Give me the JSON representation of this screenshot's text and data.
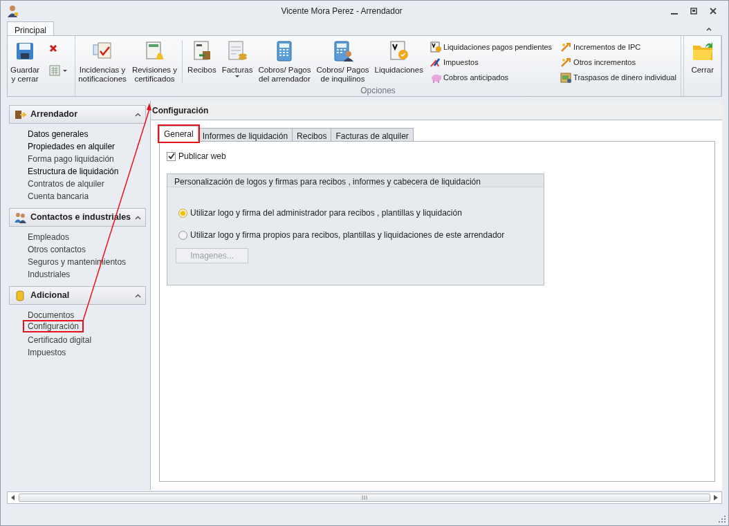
{
  "window": {
    "title": "Vicente Mora Perez - Arrendador"
  },
  "ribbon_tabs": [
    {
      "label": "Principal",
      "selected": true
    }
  ],
  "ribbon_groups": [
    {
      "items": [
        {
          "kind": "large",
          "label": "Guardar\ny cerrar"
        },
        {
          "kind": "small_stack",
          "items": [
            {
              "kind": "icon"
            },
            {
              "kind": "icon_menu"
            }
          ]
        }
      ]
    },
    {
      "label": "Opciones",
      "items": [
        {
          "kind": "large",
          "label": "Incidencias y\nnotificaciones"
        },
        {
          "kind": "large",
          "label": "Revisiones y\ncertificados"
        },
        {
          "kind": "separator"
        },
        {
          "kind": "large",
          "label": "Recibos"
        },
        {
          "kind": "large_menu",
          "label": "Facturas"
        },
        {
          "kind": "large",
          "label": "Cobros/ Pagos\ndel arrendador"
        },
        {
          "kind": "large",
          "label": "Cobros/ Pagos\nde inquilinos"
        },
        {
          "kind": "large",
          "label": "Liquidaciones"
        },
        {
          "kind": "small_stack",
          "items": [
            {
              "kind": "text",
              "label": "Liquidaciones pagos pendientes"
            },
            {
              "kind": "text",
              "label": "Impuestos"
            },
            {
              "kind": "text",
              "label": "Cobros anticipados"
            }
          ]
        },
        {
          "kind": "small_stack",
          "items": [
            {
              "kind": "text",
              "label": "Incrementos de IPC"
            },
            {
              "kind": "text",
              "label": "Otros incrementos"
            },
            {
              "kind": "text",
              "label": "Traspasos de dinero individual"
            }
          ]
        }
      ]
    },
    {
      "items": [
        {
          "kind": "large",
          "label": "Cerrar"
        }
      ]
    }
  ],
  "sidebar": [
    {
      "title": "Arrendador",
      "expanded": true,
      "items": [
        {
          "label": "Datos generales",
          "emphasized": true,
          "highlighted": false
        },
        {
          "label": "Propiedades en alquiler",
          "emphasized": true,
          "highlighted": false
        },
        {
          "label": "Forma pago liquidación",
          "emphasized": false,
          "highlighted": false
        },
        {
          "label": "Estructura de liquidación",
          "emphasized": true,
          "highlighted": false
        },
        {
          "label": "Contratos de alquiler",
          "emphasized": false,
          "highlighted": false
        },
        {
          "label": "Cuenta bancaria",
          "emphasized": false,
          "highlighted": false
        }
      ]
    },
    {
      "title": "Contactos e industriales",
      "expanded": true,
      "items": [
        {
          "label": "Empleados",
          "emphasized": false,
          "highlighted": false
        },
        {
          "label": "Otros contactos",
          "emphasized": false,
          "highlighted": false
        },
        {
          "label": "Seguros y mantenimientos",
          "emphasized": false,
          "highlighted": false
        },
        {
          "label": "Industriales",
          "emphasized": false,
          "highlighted": false
        }
      ]
    },
    {
      "title": "Adicional",
      "expanded": true,
      "items": [
        {
          "label": "Documentos",
          "emphasized": false,
          "highlighted": false
        },
        {
          "label": "Configuración",
          "emphasized": false,
          "highlighted": true
        },
        {
          "label": "Certificado digital",
          "emphasized": false,
          "highlighted": false
        },
        {
          "label": "Impuestos",
          "emphasized": false,
          "highlighted": false
        }
      ]
    }
  ],
  "content": {
    "title": "Configuración",
    "tabs": [
      {
        "label": "General",
        "selected": true,
        "highlighted": true
      },
      {
        "label": "Informes de liquidación",
        "selected": false,
        "highlighted": false
      },
      {
        "label": "Recibos",
        "selected": false,
        "highlighted": false
      },
      {
        "label": "Facturas de alquiler",
        "selected": false,
        "highlighted": false
      }
    ],
    "publish_checkbox": {
      "label": "Publicar web",
      "checked": true
    },
    "group_box": {
      "title": "Personalización de logos y firmas para recibos , informes y cabecera de liquidación",
      "options": [
        {
          "label": "Utilizar logo y firma del administrador para recibos , plantillas y liquidación",
          "selected": true
        },
        {
          "label": "Utilizar logo y firma propios para recibos, plantillas y liquidaciones de este arrendador",
          "selected": false
        }
      ],
      "button": {
        "label": "Imagenes...",
        "disabled": true
      }
    }
  }
}
